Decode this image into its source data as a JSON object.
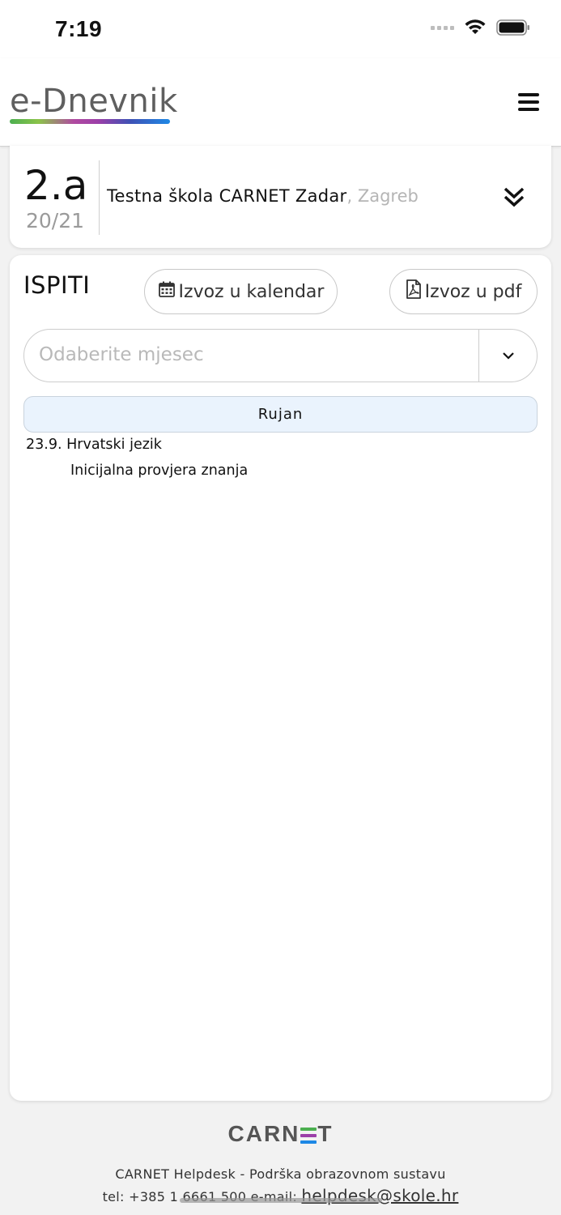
{
  "status_bar": {
    "time": "7:19"
  },
  "header": {
    "logo": "e-Dnevnik"
  },
  "class_info": {
    "class_name": "2.a",
    "school_year": "20/21",
    "school_name": "Testna škola CARNET Zadar",
    "school_city": ", Zagreb"
  },
  "exams": {
    "title": "ISPITI",
    "export_calendar_label": "Izvoz u kalendar",
    "export_pdf_label": "Izvoz u pdf",
    "month_placeholder": "Odaberite mjesec",
    "month_header": "Rujan",
    "items": [
      {
        "date": "23.9.",
        "subject": "Hrvatski jezik",
        "description": "Inicijalna provjera znanja"
      }
    ]
  },
  "footer": {
    "logo_prefix": "CARN",
    "logo_suffix": "T",
    "helpdesk_line": "CARNET Helpdesk - Podrška obrazovnom sustavu",
    "contact_text": "tel: +385 1 6661 500 e-mail: ",
    "email": "helpdesk@skole.hr"
  },
  "colors": {
    "accent_blue": "#1e88e5",
    "month_header_bg": "#eaf3fd",
    "logo_gradient": [
      "#4caf50",
      "#9c3fa8",
      "#3f51b5",
      "#1e88e5"
    ]
  }
}
